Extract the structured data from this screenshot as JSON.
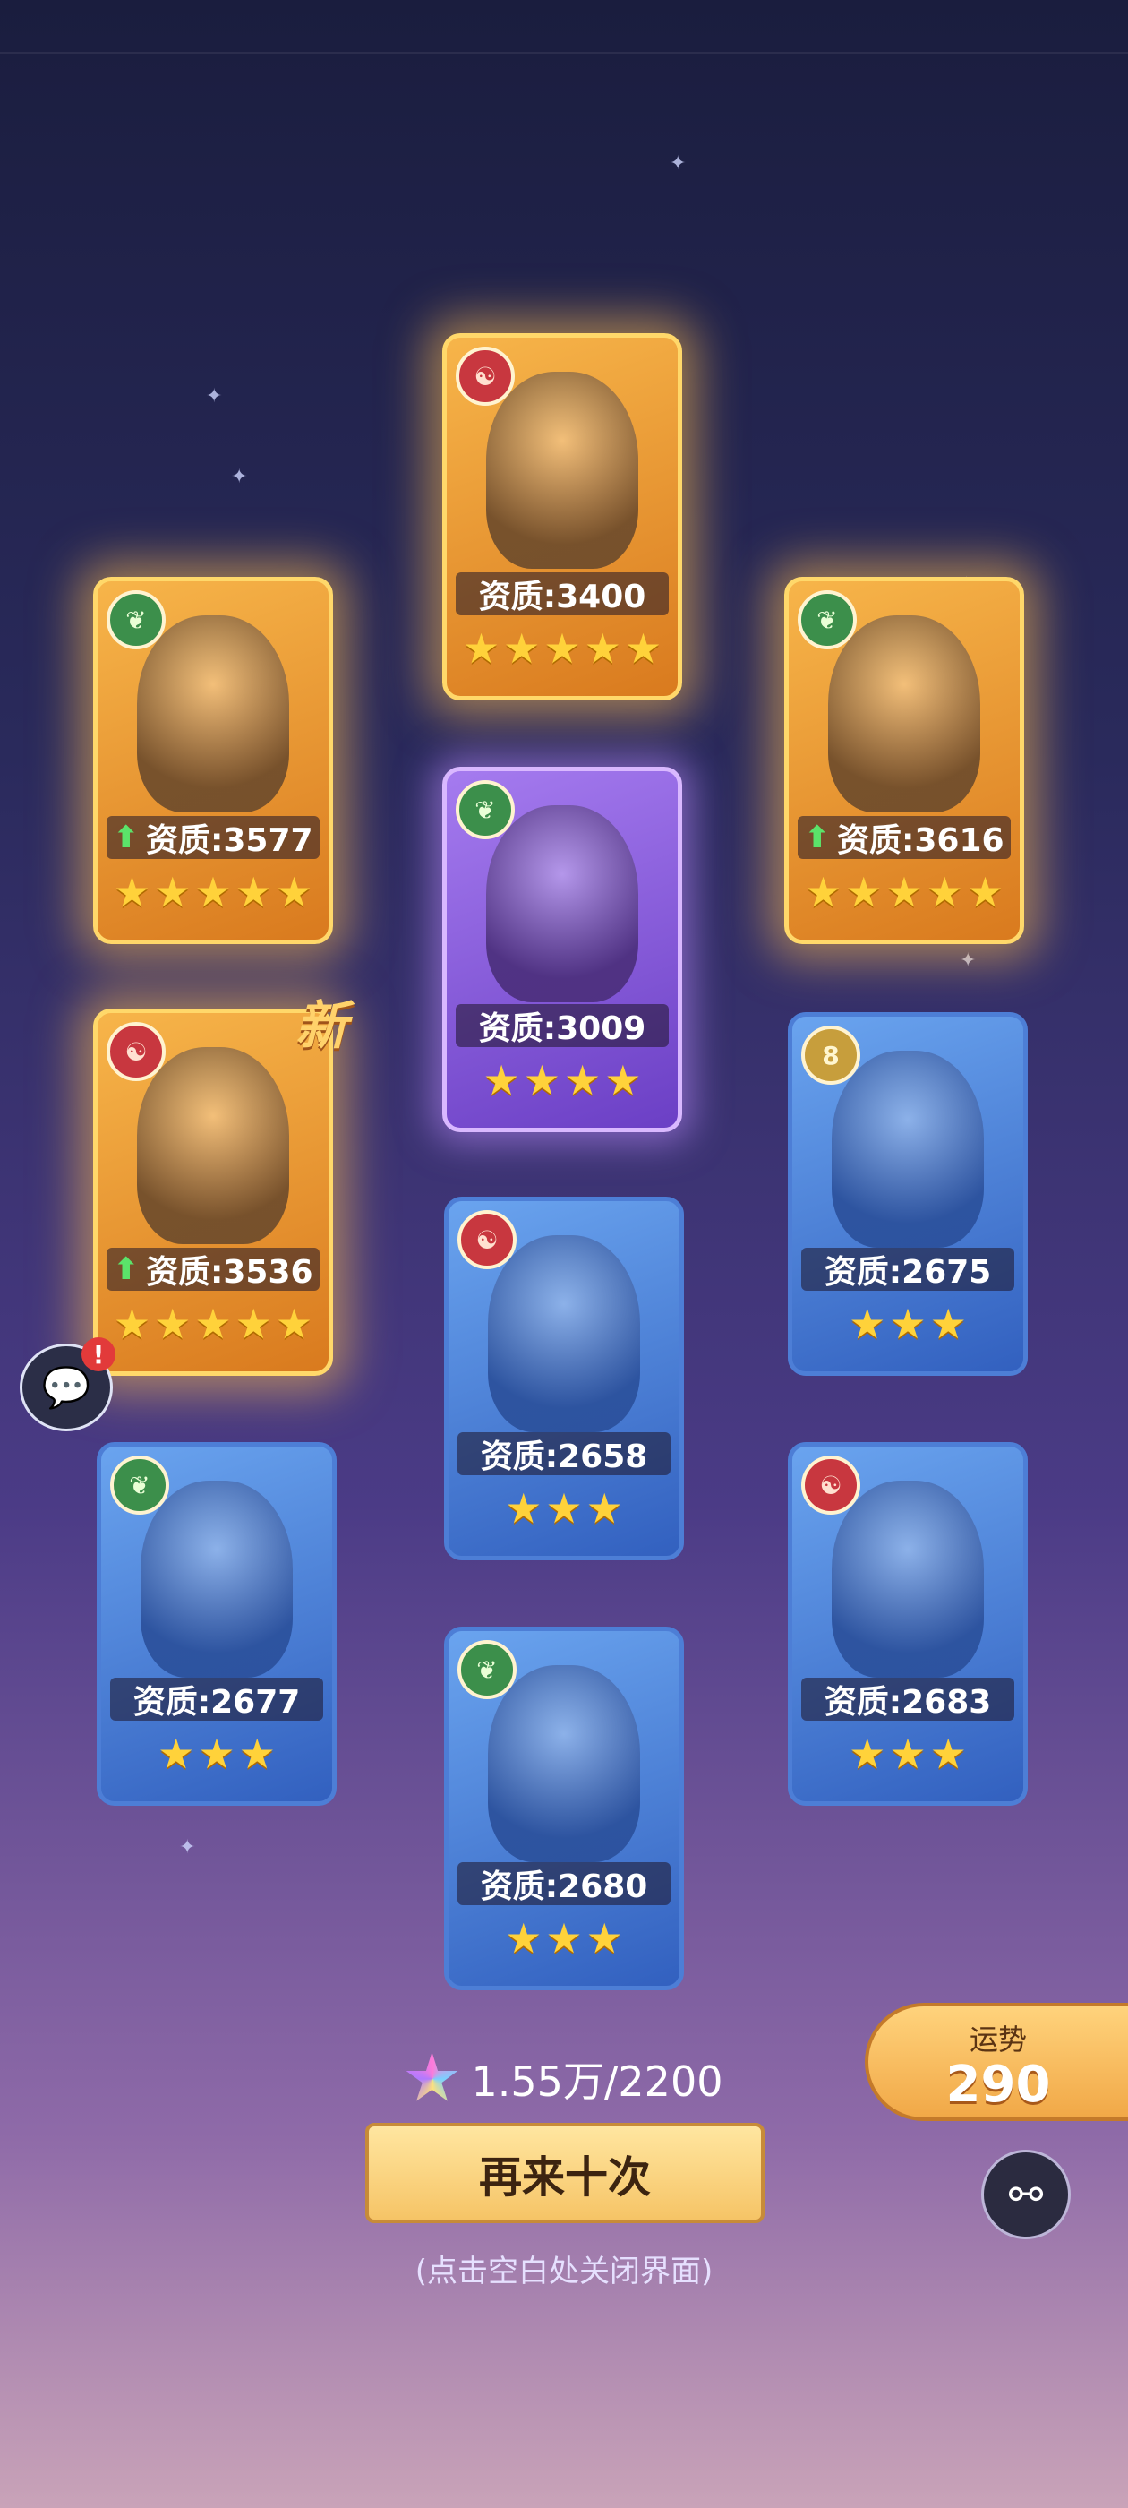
{
  "cards": [
    {
      "id": "c1",
      "rarity": "gold",
      "element": "fire",
      "element_glyph": "☯",
      "stat_label": "资质:3400",
      "up": false,
      "stars": 5,
      "new": false
    },
    {
      "id": "c2",
      "rarity": "gold",
      "element": "leaf",
      "element_glyph": "❦",
      "stat_label": "资质:3577",
      "up": true,
      "stars": 5,
      "new": false
    },
    {
      "id": "c3",
      "rarity": "gold",
      "element": "leaf",
      "element_glyph": "❦",
      "stat_label": "资质:3616",
      "up": true,
      "stars": 5,
      "new": false
    },
    {
      "id": "c4",
      "rarity": "purple",
      "element": "leaf",
      "element_glyph": "❦",
      "stat_label": "资质:3009",
      "up": false,
      "stars": 4,
      "new": false
    },
    {
      "id": "c5",
      "rarity": "gold",
      "element": "fire",
      "element_glyph": "☯",
      "stat_label": "资质:3536",
      "up": true,
      "stars": 5,
      "new": true
    },
    {
      "id": "c6",
      "rarity": "blue",
      "element": "gold8",
      "element_glyph": "8",
      "stat_label": "资质:2675",
      "up": false,
      "stars": 3,
      "new": false
    },
    {
      "id": "c7",
      "rarity": "blue",
      "element": "fire",
      "element_glyph": "☯",
      "stat_label": "资质:2658",
      "up": false,
      "stars": 3,
      "new": false
    },
    {
      "id": "c8",
      "rarity": "blue",
      "element": "leaf",
      "element_glyph": "❦",
      "stat_label": "资质:2677",
      "up": false,
      "stars": 3,
      "new": false
    },
    {
      "id": "c9",
      "rarity": "blue",
      "element": "fire",
      "element_glyph": "☯",
      "stat_label": "资质:2683",
      "up": false,
      "stars": 3,
      "new": false
    },
    {
      "id": "c10",
      "rarity": "blue",
      "element": "leaf",
      "element_glyph": "❦",
      "stat_label": "资质:2680",
      "up": false,
      "stars": 3,
      "new": false
    }
  ],
  "new_label": "新",
  "fortune": {
    "label": "运势",
    "value": "290"
  },
  "cost": {
    "text": "1.55万/2200",
    "icon": "star-gem-icon"
  },
  "again_button": "再来十次",
  "hint": "(点击空白处关闭界面)",
  "colors": {
    "gold": "#ffd86a",
    "purple": "#d9b8ff",
    "blue": "#4d7ed6"
  }
}
